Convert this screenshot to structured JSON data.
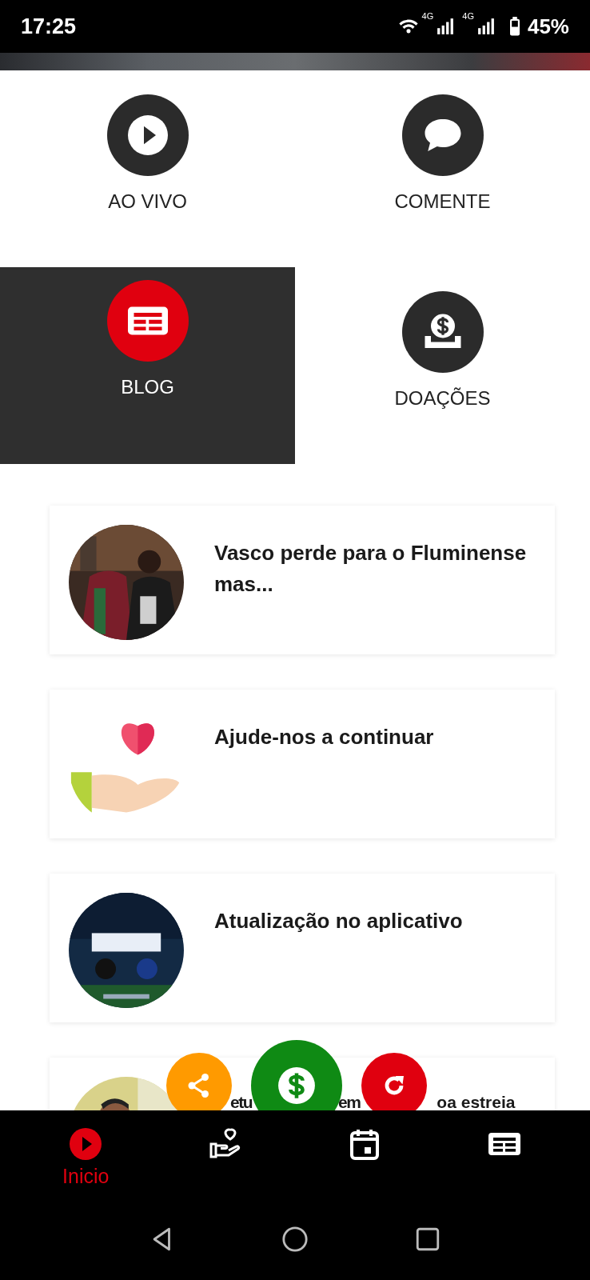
{
  "status_bar": {
    "time": "17:25",
    "network_1": "4G",
    "network_2": "4G",
    "battery": "45%"
  },
  "menu": [
    {
      "label": "AO VIVO",
      "kind": "play",
      "selected": false
    },
    {
      "label": "COMENTE",
      "kind": "chat",
      "selected": false
    },
    {
      "label": "BLOG",
      "kind": "news",
      "selected": true
    },
    {
      "label": "DOAÇÕES",
      "kind": "donate",
      "selected": false
    }
  ],
  "posts": [
    {
      "title": "Vasco perde para o Fluminense mas...",
      "kind": "picture"
    },
    {
      "title": "Ajude-nos a continuar",
      "kind": "illustration"
    },
    {
      "title": "Atualização no aplicativo",
      "kind": "picture"
    },
    {
      "title_fragments": [
        "etu",
        "em",
        "oa estreia"
      ],
      "kind": "picture"
    }
  ],
  "fabs": [
    {
      "kind": "share"
    },
    {
      "kind": "donate"
    },
    {
      "kind": "refresh"
    }
  ],
  "bottom_nav": [
    {
      "label": "Inicio",
      "kind": "play",
      "selected": true
    },
    {
      "kind": "charity",
      "selected": false
    },
    {
      "kind": "calendar",
      "selected": false
    },
    {
      "kind": "news",
      "selected": false
    }
  ]
}
